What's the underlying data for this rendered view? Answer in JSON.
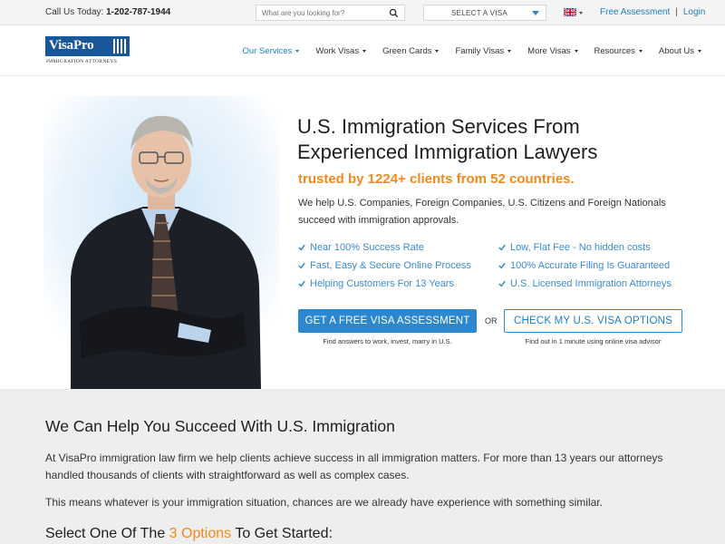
{
  "topbar": {
    "call_label": "Call Us Today:",
    "phone": "1-202-787-1944",
    "search_placeholder": "What are you looking for?",
    "visa_select": "SELECT A VISA",
    "language_icon": "uk-flag-icon",
    "links": [
      "Free Assessment",
      "Login"
    ],
    "separator": "|"
  },
  "header": {
    "logo_word": "VisaPro",
    "logo_tagline": "IMMIGRATION ATTORNEYS",
    "nav": [
      {
        "label": "Our Services",
        "active": true
      },
      {
        "label": "Work Visas",
        "active": false
      },
      {
        "label": "Green Cards",
        "active": false
      },
      {
        "label": "Family Visas",
        "active": false
      },
      {
        "label": "More Visas",
        "active": false
      },
      {
        "label": "Resources",
        "active": false
      },
      {
        "label": "About Us",
        "active": false
      }
    ]
  },
  "hero": {
    "title_line1": "U.S. Immigration Services From",
    "title_line2": "Experienced Immigration Lawyers",
    "trusted": "trusted by 1224+ clients from 52 countries.",
    "intro": "We help U.S. Companies, Foreign Companies, U.S. Citizens and Foreign Nationals succeed with immigration approvals.",
    "checks_left": [
      "Near 100% Success Rate",
      "Fast, Easy & Secure Online Process",
      "Helping Customers For 13 Years"
    ],
    "checks_right": [
      "Low, Flat Fee - No hidden costs",
      "100% Accurate Filing Is Guaranteed",
      "U.S. Licensed Immigration Attorneys"
    ],
    "primary_button": "GET A FREE VISA ASSESSMENT",
    "or": "OR",
    "secondary_button": "CHECK MY U.S. VISA OPTIONS",
    "primary_sub": "Find answers to work, invest, marry in U.S.",
    "secondary_sub": "Find out in 1 minute using online visa advisor"
  },
  "section": {
    "heading": "We Can Help You Succeed With U.S. Immigration",
    "para1": "At VisaPro immigration law firm we help clients achieve success in all immigration matters. For more than 13 years our attorneys handled thousands of clients with straightforward as well as complex cases.",
    "para2": "This means whatever is your immigration situation, chances are we already have experience with something similar.",
    "cta_prefix": "Select One Of The ",
    "cta_highlight": "3 Options",
    "cta_suffix": " To Get Started:"
  },
  "colors": {
    "accent_blue": "#2a87d0",
    "link_blue": "#1f7fc4",
    "accent_orange": "#f08a1e",
    "logo_blue": "#17579a"
  }
}
